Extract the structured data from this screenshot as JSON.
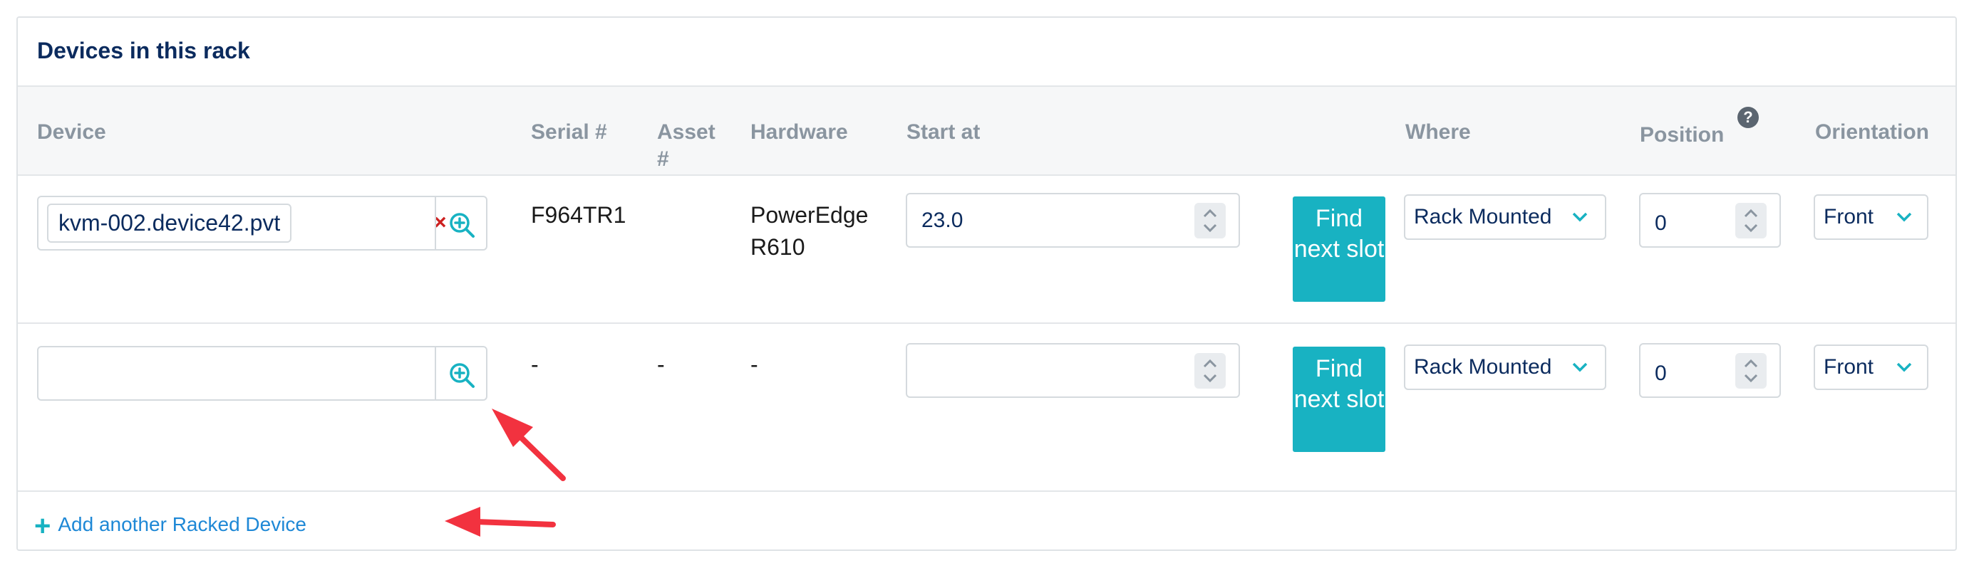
{
  "panel": {
    "title": "Devices in this rack"
  },
  "columns": {
    "device": "Device",
    "serial": "Serial #",
    "asset": "Asset #",
    "hardware": "Hardware",
    "start_at": "Start at",
    "where": "Where",
    "position": "Position",
    "position_help": "?",
    "orientation": "Orientation"
  },
  "rows": [
    {
      "device": "kvm-002.device42.pvt",
      "clear": "×",
      "serial": "F964TR1",
      "asset": "",
      "hardware": "PowerEdge R610",
      "start_at": "23.0",
      "find_button": "Find next slot",
      "where": "Rack Mounted",
      "position": "0",
      "orientation": "Front"
    },
    {
      "device": "",
      "serial": "-",
      "asset": "-",
      "hardware": "-",
      "start_at": "",
      "find_button": "Find next slot",
      "where": "Rack Mounted",
      "position": "0",
      "orientation": "Front"
    }
  ],
  "footer": {
    "add_link": "Add another Racked Device"
  },
  "icons": {
    "lookup": "magnifier-plus-icon",
    "spinner": "up-down-chevron-icon",
    "dropdown": "chevron-down-icon",
    "add": "plus-icon",
    "annotation": "red-arrow"
  },
  "colors": {
    "title": "#0b2b5e",
    "accent": "#18b2c2",
    "link": "#1e88d6",
    "clear": "#cc1f1f",
    "annotation": "#f2323f"
  }
}
